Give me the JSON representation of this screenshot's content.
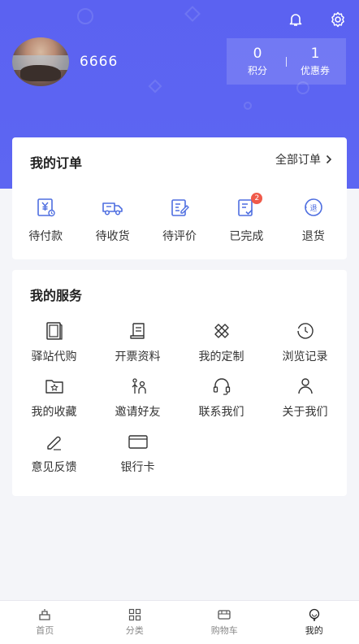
{
  "header": {
    "username": "6666",
    "stats": [
      {
        "value": "0",
        "label": "积分"
      },
      {
        "value": "1",
        "label": "优惠券"
      }
    ],
    "bg_color": "#5b62f1"
  },
  "orders": {
    "title": "我的订单",
    "all_label": "全部订单",
    "items": [
      {
        "label": "待付款",
        "icon": "wallet-icon"
      },
      {
        "label": "待收货",
        "icon": "truck-icon"
      },
      {
        "label": "待评价",
        "icon": "edit-icon"
      },
      {
        "label": "已完成",
        "icon": "checklist-icon",
        "badge": "2"
      },
      {
        "label": "退货",
        "icon": "return-icon"
      }
    ]
  },
  "services": {
    "title": "我的服务",
    "items": [
      {
        "label": "驿站代购",
        "icon": "book-icon"
      },
      {
        "label": "开票资料",
        "icon": "scroll-icon"
      },
      {
        "label": "我的定制",
        "icon": "tools-icon"
      },
      {
        "label": "浏览记录",
        "icon": "history-icon"
      },
      {
        "label": "我的收藏",
        "icon": "folder-star-icon"
      },
      {
        "label": "邀请好友",
        "icon": "invite-icon"
      },
      {
        "label": "联系我们",
        "icon": "headset-icon"
      },
      {
        "label": "关于我们",
        "icon": "user-icon"
      },
      {
        "label": "意见反馈",
        "icon": "pen-icon"
      },
      {
        "label": "银行卡",
        "icon": "card-icon"
      }
    ]
  },
  "tabbar": {
    "tabs": [
      {
        "label": "首页",
        "icon": "home-icon"
      },
      {
        "label": "分类",
        "icon": "grid-icon"
      },
      {
        "label": "购物车",
        "icon": "cart-icon"
      },
      {
        "label": "我的",
        "icon": "profile-icon",
        "active": true
      }
    ]
  }
}
